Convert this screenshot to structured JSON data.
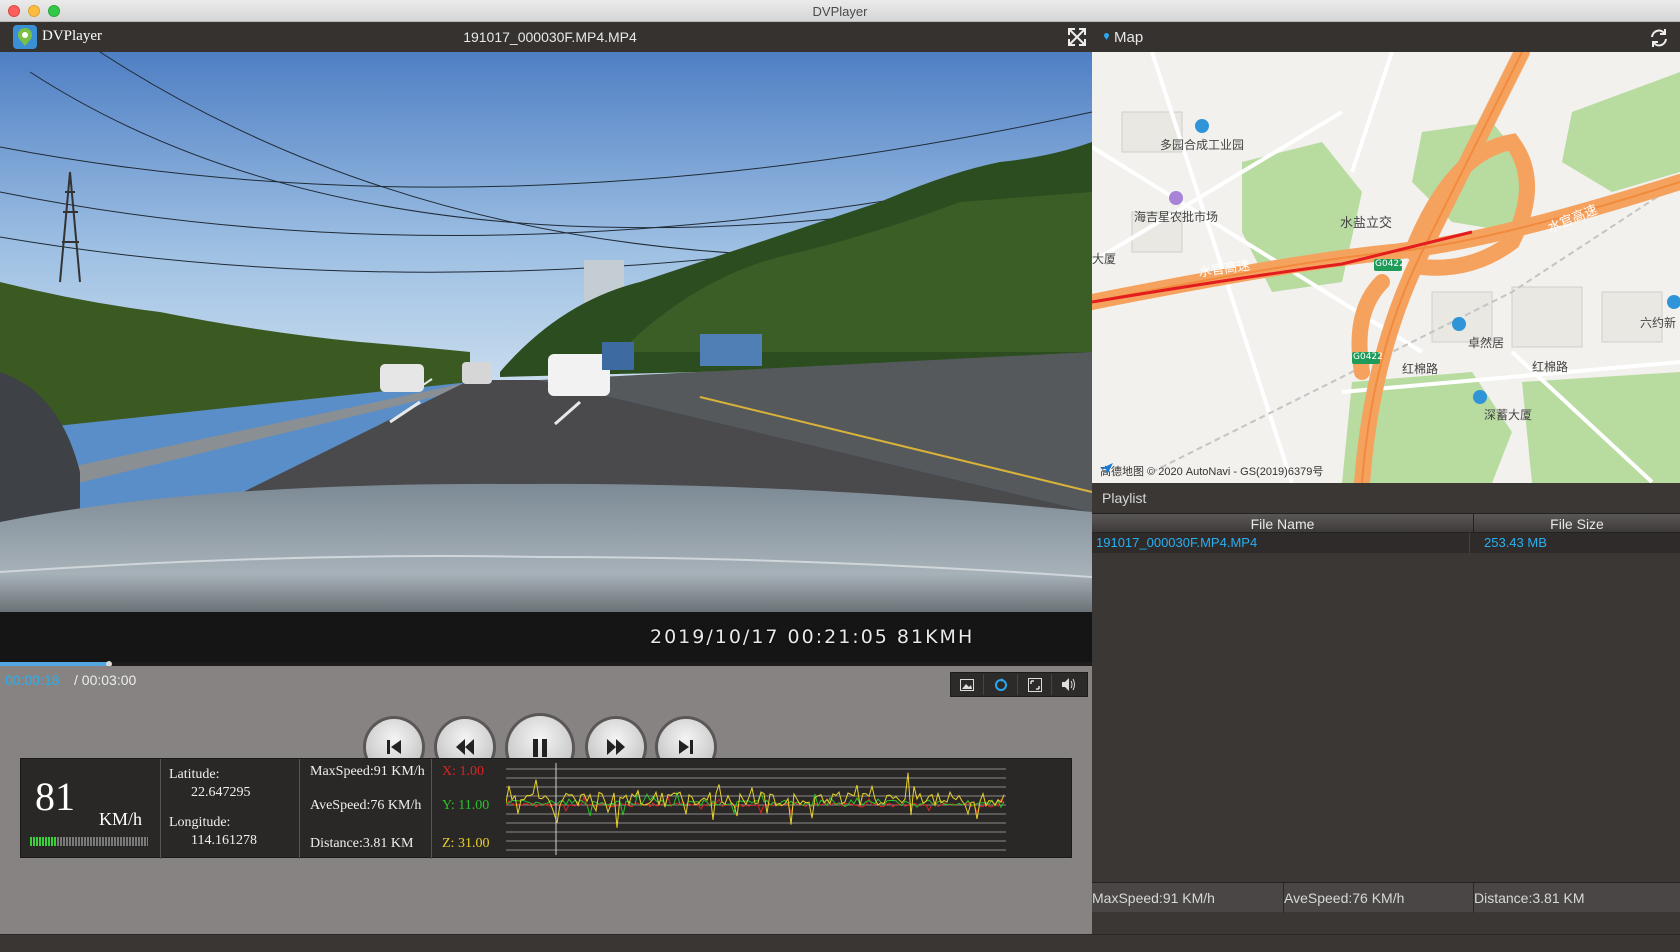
{
  "window": {
    "title": "DVPlayer"
  },
  "player": {
    "app_name": "DVPlayer",
    "file_title": "191017_000030F.MP4.MP4",
    "osd": "2019/10/17  00:21:05  81KMH",
    "progress": 0.1
  },
  "time": {
    "current": "00:00:18",
    "total": "/ 00:03:00"
  },
  "telemetry": {
    "speed": "81",
    "speed_unit": "KM/h",
    "speed_level": 0.23,
    "latitude_label": "Latitude:",
    "latitude": "22.647295",
    "longitude_label": "Longitude:",
    "longitude": "114.161278",
    "max_speed": "MaxSpeed:91 KM/h",
    "ave_speed": "AveSpeed:76 KM/h",
    "distance": "Distance:3.81 KM",
    "x": "X: 1.00",
    "y": "Y: 11.00",
    "z": "Z: 31.00",
    "colors": {
      "x": "#dd2222",
      "y": "#2dc02d",
      "z": "#e8d22a"
    }
  },
  "map": {
    "title": "Map",
    "labels": {
      "poi1": "多园合成工业园",
      "poi2": "海吉星农批市场",
      "interchange": "水盐立交",
      "road1": "水官高速",
      "road2": "水官高速",
      "dasha": "大厦",
      "zhuoran": "卓然居",
      "honmian1": "红棉路",
      "honmian2": "红棉路",
      "shenxu": "深蓄大厦",
      "liuyue": "六约新",
      "shield1": "G0422",
      "shield2": "G0422"
    },
    "attribution": "高德地图 © 2020 AutoNavi - GS(2019)6379号"
  },
  "playlist": {
    "title": "Playlist",
    "columns": [
      "File Name",
      "File Size"
    ],
    "rows": [
      {
        "name": "191017_000030F.MP4.MP4",
        "size": "253.43 MB"
      }
    ],
    "summary": {
      "max_speed": "MaxSpeed:91 KM/h",
      "ave_speed": "AveSpeed:76 KM/h",
      "distance": "Distance:3.81 KM"
    }
  }
}
